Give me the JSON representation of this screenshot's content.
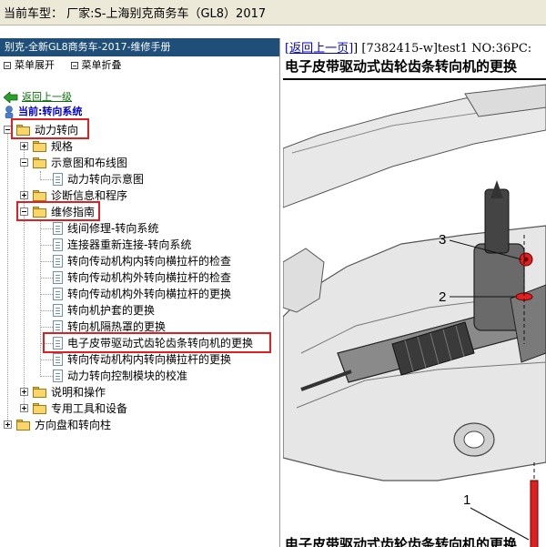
{
  "topbar": {
    "text": "当前车型：  厂家:S-上海别克商务车（GL8）2017"
  },
  "left": {
    "title": "别克-全新GL8商务车-2017-维修手册",
    "menu": {
      "expand": "菜单展开",
      "collapse": "菜单折叠"
    },
    "back": "返回上一级",
    "current": "当前:转向系统",
    "tree": [
      {
        "label": "动力转向"
      },
      {
        "label": "规格"
      },
      {
        "label": "示意图和布线图"
      },
      {
        "label": "动力转向示意图"
      },
      {
        "label": "诊断信息和程序"
      },
      {
        "label": "维修指南"
      },
      {
        "label": "线间修理-转向系统"
      },
      {
        "label": "连接器重新连接-转向系统"
      },
      {
        "label": "转向传动机构内转向横拉杆的检查"
      },
      {
        "label": "转向传动机构外转向横拉杆的检查"
      },
      {
        "label": "转向传动机构外转向横拉杆的更换"
      },
      {
        "label": "转向机护套的更换"
      },
      {
        "label": "转向机隔热罩的更换"
      },
      {
        "label": "电子皮带驱动式齿轮齿条转向机的更换"
      },
      {
        "label": "转向传动机构内转向横拉杆的更换"
      },
      {
        "label": "动力转向控制模块的校准"
      },
      {
        "label": "说明和操作"
      },
      {
        "label": "专用工具和设备"
      },
      {
        "label": "方向盘和转向柱"
      }
    ]
  },
  "right": {
    "back_link": "返回上一页",
    "doc_meta": "] [7382415-w]test1 NO:36PC:",
    "title": "电子皮带驱动式齿轮齿条转向机的更换",
    "bottom_title": "电子皮带驱动式齿轮齿条转向机的更换",
    "callouts": [
      "3",
      "2",
      "1"
    ]
  }
}
